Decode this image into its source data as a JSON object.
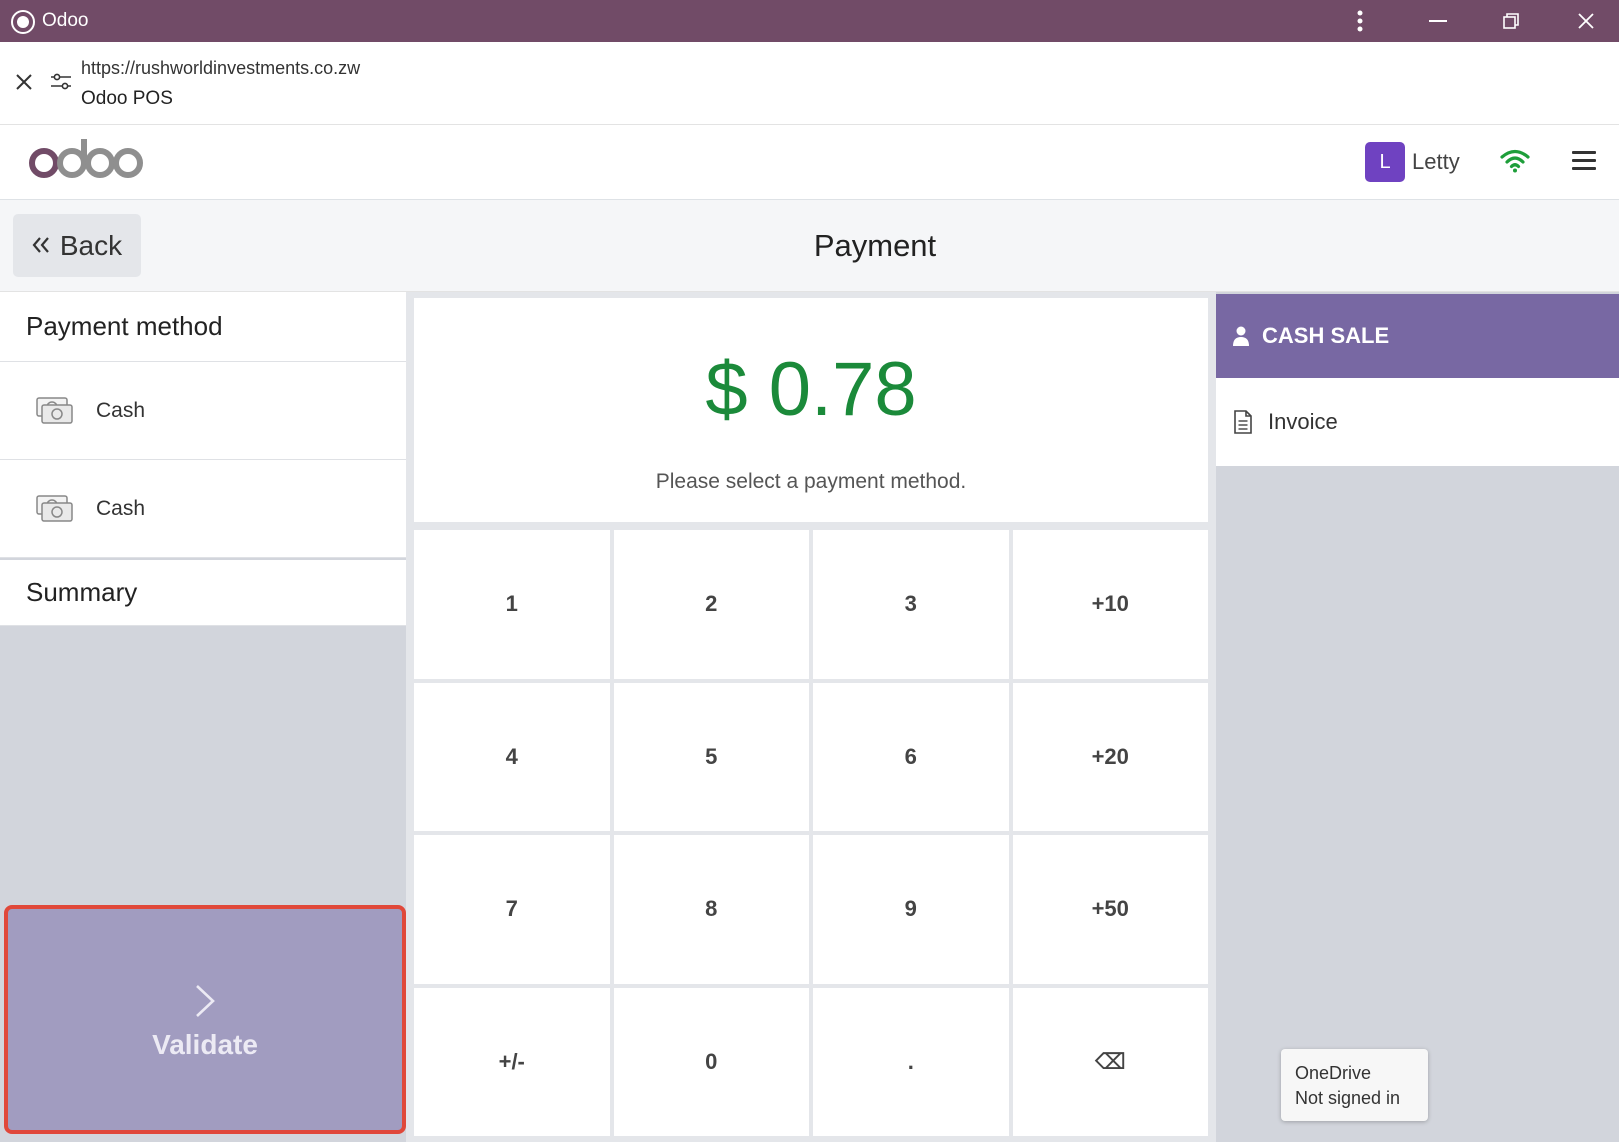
{
  "window": {
    "title": "Odoo",
    "controls": [
      "more",
      "minimize",
      "restore",
      "close"
    ]
  },
  "address": {
    "url": "https://rushworldinvestments.co.zw",
    "page_name": "Odoo POS"
  },
  "header": {
    "logo_text": "odoo",
    "user": {
      "initial": "L",
      "name": "Letty"
    },
    "status_color": "#1e9e3a"
  },
  "control": {
    "back_label": "Back",
    "title": "Payment"
  },
  "left": {
    "payment_method_title": "Payment method",
    "methods": [
      {
        "label": "Cash",
        "icon": "money-icon"
      },
      {
        "label": "Cash",
        "icon": "money-icon"
      }
    ],
    "summary_title": "Summary",
    "validate_label": "Validate"
  },
  "amount": {
    "value": "$ 0.78",
    "hint": "Please select a payment method.",
    "color": "#1b8a3a"
  },
  "numpad": {
    "keys": [
      "1",
      "2",
      "3",
      "+10",
      "4",
      "5",
      "6",
      "+20",
      "7",
      "8",
      "9",
      "+50",
      "+/-",
      "0",
      ".",
      "⌫"
    ]
  },
  "right": {
    "customer_label": "CASH SALE",
    "invoice_label": "Invoice",
    "accent": "#7868a3"
  },
  "tooltip": {
    "line1": "OneDrive",
    "line2": "Not signed in"
  }
}
